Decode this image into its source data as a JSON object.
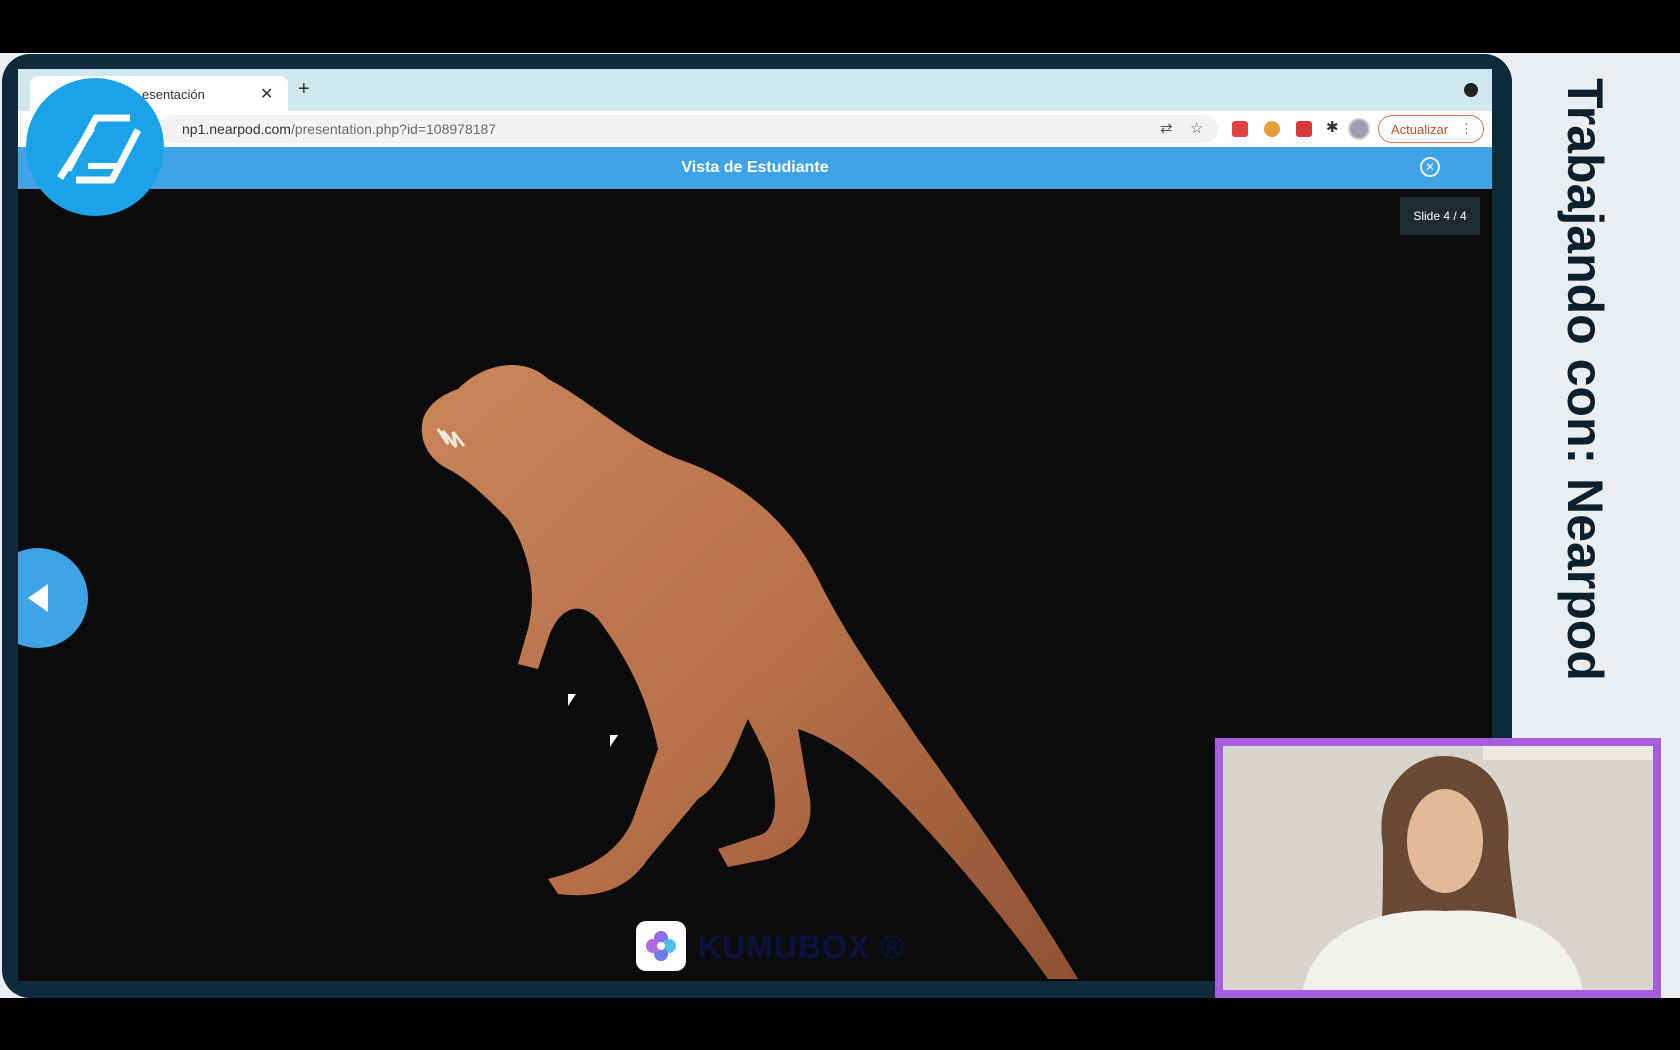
{
  "sidebar_title": "Trabajando con: Nearpod",
  "browser": {
    "tab_title": "esentación",
    "tab_close": "✕",
    "new_tab": "+",
    "url_host": "np1.nearpod.com",
    "url_path": "/presentation.php?id=108978187",
    "update_label": "Actualizar",
    "update_menu": "⋮"
  },
  "nearpod": {
    "header_title": "Vista de Estudiante",
    "close_glyph": "✕",
    "slide_counter": "Slide 4 / 4"
  },
  "brand": {
    "watermark": "KUMUBOX ®"
  },
  "colors": {
    "nearpod_blue": "#3fa3e8",
    "webcam_border": "#a55ee0",
    "update_button": "#c0502a"
  }
}
